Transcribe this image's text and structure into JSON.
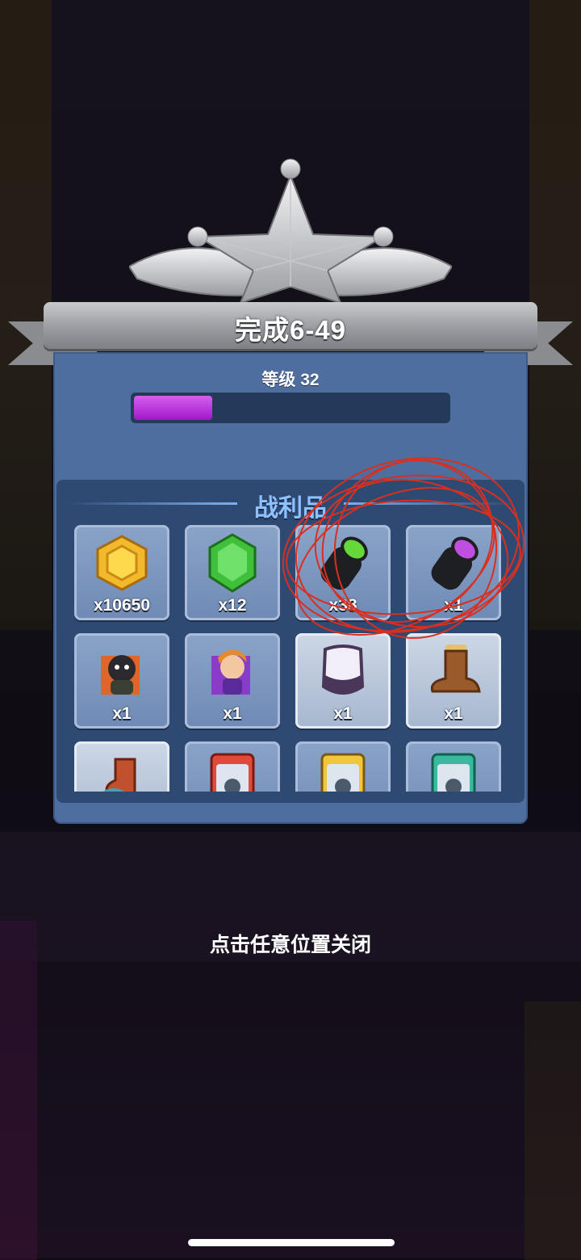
{
  "header": {
    "title": "完成6-49"
  },
  "level": {
    "label": "等级 32",
    "progress": 0.25
  },
  "loot": {
    "title": "战利品",
    "items": [
      {
        "icon": "gold-coin-icon",
        "qty": "x10650"
      },
      {
        "icon": "green-gem-icon",
        "qty": "x12"
      },
      {
        "icon": "green-canister-icon",
        "qty": "x38"
      },
      {
        "icon": "purple-canister-icon",
        "qty": "x1"
      },
      {
        "icon": "bomb-hero-puzzle-icon",
        "qty": "x1"
      },
      {
        "icon": "girl-hero-puzzle-icon",
        "qty": "x1"
      },
      {
        "icon": "armor-vest-icon",
        "qty": "x1"
      },
      {
        "icon": "brown-boot-icon",
        "qty": "x1"
      },
      {
        "icon": "red-boot-icon",
        "qty": ""
      },
      {
        "icon": "red-card-icon",
        "qty": ""
      },
      {
        "icon": "yellow-card-icon",
        "qty": ""
      },
      {
        "icon": "teal-card-icon",
        "qty": ""
      }
    ]
  },
  "footer": {
    "close_hint": "点击任意位置关闭"
  },
  "colors": {
    "panel": "#4e6e9f",
    "progress": "#c03ee0",
    "annotation": "#d83020"
  }
}
